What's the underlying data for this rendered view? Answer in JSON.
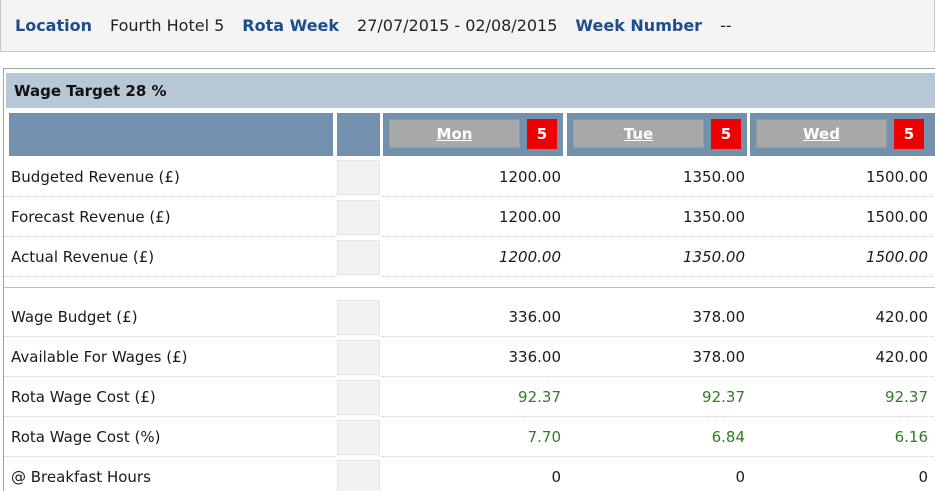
{
  "header": {
    "location_label": "Location",
    "location_value": "Fourth Hotel 5",
    "rota_week_label": "Rota Week",
    "rota_week_value": "27/07/2015 - 02/08/2015",
    "week_number_label": "Week Number",
    "week_number_value": "--"
  },
  "wage_target": "Wage Target 28 %",
  "days": [
    {
      "name": "Mon",
      "count": "5"
    },
    {
      "name": "Tue",
      "count": "5"
    },
    {
      "name": "Wed",
      "count": "5"
    }
  ],
  "rows": [
    {
      "label": "Budgeted Revenue (£)",
      "values": [
        "1200.00",
        "1350.00",
        "1500.00"
      ]
    },
    {
      "label": "Forecast Revenue (£)",
      "values": [
        "1200.00",
        "1350.00",
        "1500.00"
      ]
    },
    {
      "label": "Actual Revenue (£)",
      "values": [
        "1200.00",
        "1350.00",
        "1500.00"
      ]
    },
    {
      "label": "Wage Budget (£)",
      "values": [
        "336.00",
        "378.00",
        "420.00"
      ]
    },
    {
      "label": "Available For Wages (£)",
      "values": [
        "336.00",
        "378.00",
        "420.00"
      ]
    },
    {
      "label": "Rota Wage Cost (£)",
      "values": [
        "92.37",
        "92.37",
        "92.37"
      ]
    },
    {
      "label": "Rota Wage Cost (%)",
      "values": [
        "7.70",
        "6.84",
        "6.16"
      ]
    },
    {
      "label": "@ Breakfast Hours",
      "values": [
        "0",
        "0",
        "0"
      ]
    }
  ],
  "colors": {
    "header_label": "#1e4d8c",
    "day_header_bg": "#7390ad",
    "badge": "#ee0000",
    "wage_cost": "#2f7d22"
  }
}
